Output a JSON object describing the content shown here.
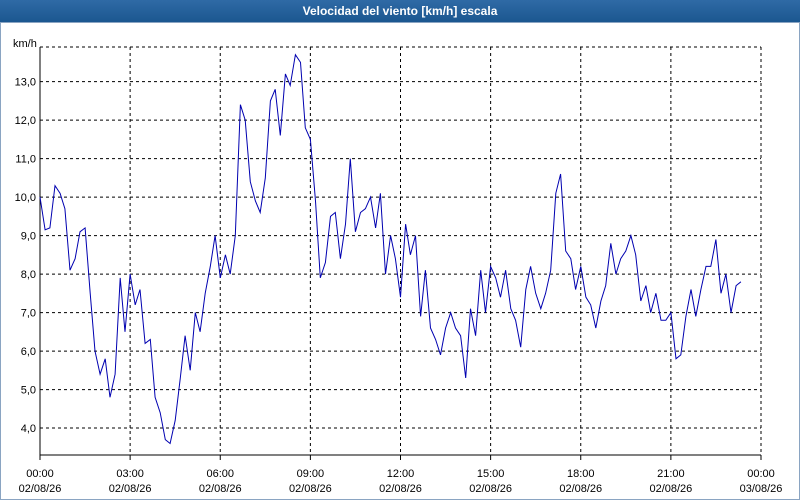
{
  "window": {
    "title": "Velocidad del viento [km/h] escala"
  },
  "chart_data": {
    "type": "line",
    "title": "Velocidad del viento [km/h] escala",
    "ylabel": "km/h",
    "xlabel": "",
    "ylim": [
      3.3,
      13.9
    ],
    "xlim": [
      0,
      24
    ],
    "grid": true,
    "line_color": "#0000b0",
    "y_ticks": [
      {
        "value": 4.0,
        "label": "4,0"
      },
      {
        "value": 5.0,
        "label": "5,0"
      },
      {
        "value": 6.0,
        "label": "6,0"
      },
      {
        "value": 7.0,
        "label": "7,0"
      },
      {
        "value": 8.0,
        "label": "8,0"
      },
      {
        "value": 9.0,
        "label": "9,0"
      },
      {
        "value": 10.0,
        "label": "10,0"
      },
      {
        "value": 11.0,
        "label": "11,0"
      },
      {
        "value": 12.0,
        "label": "12,0"
      },
      {
        "value": 13.0,
        "label": "13,0"
      }
    ],
    "x_ticks": [
      {
        "hour": 0,
        "time": "00:00",
        "date": "02/08/26"
      },
      {
        "hour": 3,
        "time": "03:00",
        "date": "02/08/26"
      },
      {
        "hour": 6,
        "time": "06:00",
        "date": "02/08/26"
      },
      {
        "hour": 9,
        "time": "09:00",
        "date": "02/08/26"
      },
      {
        "hour": 12,
        "time": "12:00",
        "date": "02/08/26"
      },
      {
        "hour": 15,
        "time": "15:00",
        "date": "02/08/26"
      },
      {
        "hour": 18,
        "time": "18:00",
        "date": "02/08/26"
      },
      {
        "hour": 21,
        "time": "21:00",
        "date": "02/08/26"
      },
      {
        "hour": 24,
        "time": "00:00",
        "date": "03/08/26"
      }
    ],
    "x": [
      0,
      0.17,
      0.33,
      0.5,
      0.67,
      0.83,
      1.0,
      1.17,
      1.33,
      1.5,
      1.67,
      1.83,
      2.0,
      2.17,
      2.33,
      2.5,
      2.67,
      2.83,
      3.0,
      3.17,
      3.33,
      3.5,
      3.67,
      3.83,
      4.0,
      4.17,
      4.33,
      4.5,
      4.67,
      4.83,
      5.0,
      5.17,
      5.33,
      5.5,
      5.67,
      5.83,
      6.0,
      6.17,
      6.33,
      6.5,
      6.67,
      6.83,
      7.0,
      7.17,
      7.33,
      7.5,
      7.67,
      7.83,
      8.0,
      8.17,
      8.33,
      8.5,
      8.67,
      8.83,
      9.0,
      9.17,
      9.33,
      9.5,
      9.67,
      9.83,
      10.0,
      10.17,
      10.33,
      10.5,
      10.67,
      10.83,
      11.0,
      11.17,
      11.33,
      11.5,
      11.67,
      11.83,
      12.0,
      12.17,
      12.33,
      12.5,
      12.67,
      12.83,
      13.0,
      13.17,
      13.33,
      13.5,
      13.67,
      13.83,
      14.0,
      14.17,
      14.33,
      14.5,
      14.67,
      14.83,
      15.0,
      15.17,
      15.33,
      15.5,
      15.67,
      15.83,
      16.0,
      16.17,
      16.33,
      16.5,
      16.67,
      16.83,
      17.0,
      17.17,
      17.33,
      17.5,
      17.67,
      17.83,
      18.0,
      18.17,
      18.33,
      18.5,
      18.67,
      18.83,
      19.0,
      19.17,
      19.33,
      19.5,
      19.67,
      19.83,
      20.0,
      20.17,
      20.33,
      20.5,
      20.67,
      20.83,
      21.0,
      21.17,
      21.33,
      21.5,
      21.67,
      21.83,
      22.0,
      22.17,
      22.33,
      22.5,
      22.67,
      22.83,
      23.0,
      23.17,
      23.33,
      23.5,
      23.67,
      23.83,
      24.0
    ],
    "values": [
      10.0,
      9.15,
      9.2,
      10.3,
      10.1,
      9.7,
      8.1,
      8.4,
      9.1,
      9.2,
      7.5,
      6.0,
      5.4,
      5.8,
      4.8,
      5.4,
      7.9,
      6.5,
      8.0,
      7.2,
      7.6,
      6.2,
      6.3,
      4.8,
      4.4,
      3.7,
      3.6,
      4.2,
      5.3,
      6.4,
      5.5,
      7.0,
      6.5,
      7.5,
      8.2,
      9.0,
      7.9,
      8.5,
      8.0,
      9.0,
      12.4,
      12.0,
      10.4,
      9.9,
      9.6,
      10.5,
      12.5,
      12.8,
      11.6,
      13.2,
      12.9,
      13.7,
      13.5,
      11.8,
      11.5,
      9.9,
      7.9,
      8.3,
      9.5,
      9.6,
      8.4,
      9.3,
      11.0,
      9.1,
      9.6,
      9.7,
      10.0,
      9.2,
      10.1,
      8.0,
      9.0,
      8.4,
      7.4,
      9.3,
      8.5,
      9.0,
      6.9,
      8.1,
      6.6,
      6.3,
      5.9,
      6.6,
      7.0,
      6.6,
      6.4,
      5.3,
      7.1,
      6.4,
      8.1,
      7.0,
      8.2,
      7.9,
      7.4,
      8.1,
      7.1,
      6.8,
      6.1,
      7.6,
      8.2,
      7.5,
      7.1,
      7.5,
      8.1,
      10.1,
      10.6,
      8.6,
      8.4,
      7.6,
      8.2,
      7.4,
      7.2,
      6.6,
      7.3,
      7.7,
      8.8,
      8.0,
      8.4,
      8.6,
      9.0,
      8.5,
      7.3,
      7.7,
      7.0,
      7.5,
      6.8,
      6.8,
      7.0,
      5.8,
      5.9,
      6.9,
      7.6,
      6.9,
      7.6,
      8.2,
      8.2,
      8.9,
      7.5,
      8.0,
      7.0,
      7.7,
      7.8
    ]
  }
}
